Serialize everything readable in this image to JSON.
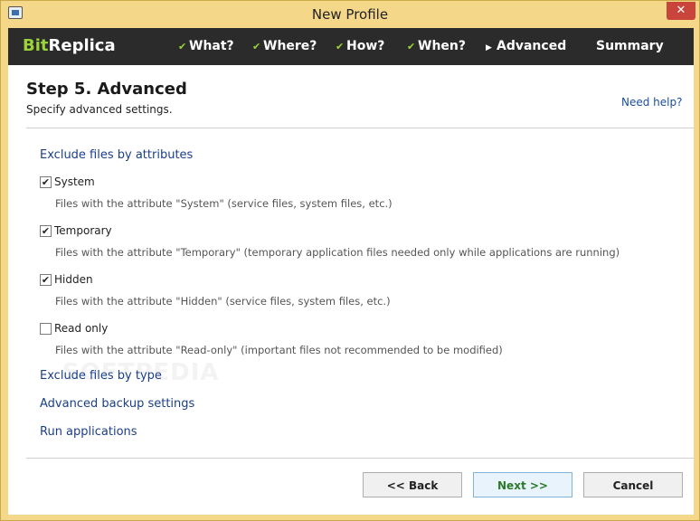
{
  "window": {
    "title": "New Profile",
    "close_glyph": "✕"
  },
  "logo": {
    "part1": "Bit",
    "part2": "Replica"
  },
  "nav": {
    "items": [
      {
        "label": "What?",
        "mark": "✔"
      },
      {
        "label": "Where?",
        "mark": "✔"
      },
      {
        "label": "How?",
        "mark": "✔"
      },
      {
        "label": "When?",
        "mark": "✔"
      },
      {
        "label": "Advanced",
        "mark": "▶"
      },
      {
        "label": "Summary",
        "mark": ""
      }
    ]
  },
  "page": {
    "title": "Step 5. Advanced",
    "subtitle": "Specify advanced settings.",
    "help_link": "Need help?"
  },
  "sections": {
    "attributes": "Exclude files by attributes",
    "type": "Exclude files by type",
    "backup": "Advanced backup settings",
    "run": "Run applications"
  },
  "checkboxes": [
    {
      "label": "System",
      "checked": true,
      "mark": "✔",
      "description": "Files with the attribute \"System\" (service files, system files, etc.)"
    },
    {
      "label": "Temporary",
      "checked": true,
      "mark": "✔",
      "description": "Files with the attribute \"Temporary\" (temporary application files needed only while applications are running)"
    },
    {
      "label": "Hidden",
      "checked": true,
      "mark": "✔",
      "description": "Files with the attribute \"Hidden\" (service files, system files, etc.)"
    },
    {
      "label": "Read only",
      "checked": false,
      "mark": "",
      "description": "Files with the attribute \"Read-only\" (important files not recommended to be modified)"
    }
  ],
  "watermark": "SOFTPEDIA",
  "buttons": {
    "back": "<< Back",
    "next": "Next >>",
    "cancel": "Cancel"
  },
  "colors": {
    "frame": "#f5d78a",
    "navbar": "#2b2b2b",
    "accent_green": "#9bd43a",
    "link_blue": "#1a3f8a",
    "close_red": "#c9443a"
  }
}
